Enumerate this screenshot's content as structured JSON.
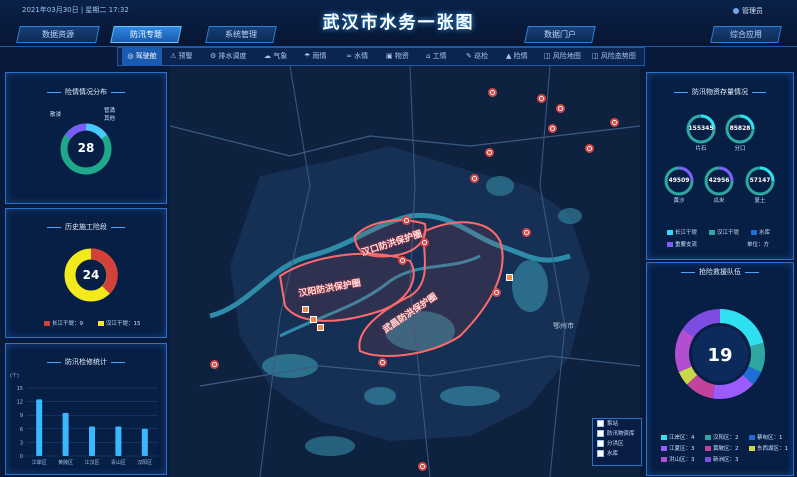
{
  "header": {
    "title": "武汉市水务一张图",
    "datetime": "2021年03月30日 | 星期二 17:32",
    "user": "管理员"
  },
  "nav": {
    "left": [
      {
        "label": "数据资源",
        "active": false
      },
      {
        "label": "防汛专题",
        "active": true
      },
      {
        "label": "系统管理",
        "active": false
      }
    ],
    "right": [
      {
        "label": "数据门户",
        "active": false
      },
      {
        "label": "综合应用",
        "active": false
      }
    ]
  },
  "tabs": [
    {
      "label": "驾驶舱",
      "active": true
    },
    {
      "label": "预警"
    },
    {
      "label": "排水调度"
    },
    {
      "label": "气象"
    },
    {
      "label": "雨情"
    },
    {
      "label": "水情"
    },
    {
      "label": "物资"
    },
    {
      "label": "工情"
    },
    {
      "label": "巡检"
    },
    {
      "label": "险情"
    },
    {
      "label": "风险地图"
    },
    {
      "label": "风险态势图"
    }
  ],
  "panels": {
    "risk": {
      "title": "险情情况分布",
      "total": "28",
      "labels": [
        "管涌",
        "其他",
        "散浸"
      ],
      "colors": [
        "#1fa88a",
        "#49c7ff",
        "#7b5cff"
      ]
    },
    "worksite": {
      "title": "历史施工险段",
      "total": "24",
      "legend": [
        {
          "label": "长江干堤：9",
          "color": "#d2413a"
        },
        {
          "label": "汉江干堤：15",
          "color": "#f2ea1a"
        }
      ]
    },
    "inspection": {
      "title": "防汛检修统计",
      "y_label": "(个)",
      "yticks": [
        "0",
        "3",
        "6",
        "9",
        "12",
        "15"
      ],
      "categories": [
        "江岸区",
        "黄陂区",
        "江汉区",
        "青山区",
        "汉阳区"
      ],
      "values": [
        12.5,
        9.5,
        6.5,
        6.5,
        6
      ]
    },
    "materials": {
      "title": "防汛物资存量情况",
      "items": [
        {
          "value": "155345",
          "label": "片石"
        },
        {
          "value": "85828",
          "label": "分口"
        },
        {
          "value": "49509",
          "label": "黄沙"
        },
        {
          "value": "42956",
          "label": "瓜米"
        },
        {
          "value": "57147",
          "label": "复土"
        }
      ],
      "legend": [
        {
          "label": "长江干堤",
          "color": "#34d6ff"
        },
        {
          "label": "汉江干堤",
          "color": "#2ea7a0"
        },
        {
          "label": "水库",
          "color": "#1f6ed8"
        },
        {
          "label": "重要支流",
          "color": "#7b5cff"
        }
      ],
      "unit": "单位：方"
    },
    "teams": {
      "title": "抢险救援队伍",
      "total": "19",
      "legend": [
        {
          "label": "江岸区：4",
          "color": "#2fe0f0"
        },
        {
          "label": "汉阳区：2",
          "color": "#2ea7a0"
        },
        {
          "label": "蔡甸区：1",
          "color": "#1f6ed8"
        },
        {
          "label": "江夏区：3",
          "color": "#9b5cff"
        },
        {
          "label": "黄陂区：2",
          "color": "#c1439c"
        },
        {
          "label": "东西湖区：1",
          "color": "#c9d94a"
        },
        {
          "label": "洪山区：3",
          "color": "#b24fd0"
        },
        {
          "label": "新洲区：3",
          "color": "#7d4ce0"
        }
      ]
    }
  },
  "map": {
    "labels": [
      {
        "text": "汉口防洪保护圈"
      },
      {
        "text": "汉阳防洪保护圈"
      },
      {
        "text": "武昌防洪保护圈"
      }
    ],
    "place": "鄂州市",
    "legend": [
      {
        "label": "泵站",
        "checked": true
      },
      {
        "label": "防汛物资库",
        "checked": true
      },
      {
        "label": "分洪区"
      },
      {
        "label": "水库"
      }
    ]
  }
}
